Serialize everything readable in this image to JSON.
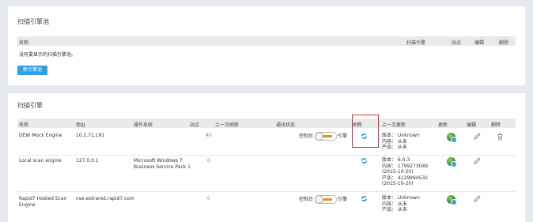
{
  "pool_panel": {
    "title": "扫描引擎池",
    "headers": {
      "name": "名称",
      "engines": "扫描引擎",
      "sites": "站点",
      "edit": "编辑",
      "delete": "删除"
    },
    "empty_text": "没有要显示的扫描引擎池。",
    "create_button": "新引擎池"
  },
  "engine_panel": {
    "title": "扫描引擎",
    "headers": {
      "name": "名称",
      "address": "地址",
      "os": "操作系统",
      "sites": "站点",
      "last_refresh": "上一次刷新",
      "comm_status": "通讯状态",
      "refresh": "刷新",
      "last_update": "上一次更新",
      "update": "更新",
      "edit": "编辑",
      "delete": "删除"
    },
    "toggle_left": "控制台",
    "toggle_right": "引擎",
    "rows": [
      {
        "name": "DEW Mock Engine",
        "address": "10.2.71.191",
        "os": "",
        "sites": "40",
        "update_lines": [
          "版本： Unknown",
          "内容： 从未",
          "产品： 从未"
        ],
        "has_delete": true
      },
      {
        "name": "Local scan engine",
        "address": "127.0.0.1",
        "os": "Microsoft Windows 7 Business Service Pack 1",
        "sites": "0",
        "update_lines": [
          "版本： 6.0.3",
          "内容： 1799273049",
          "(2015-10-20)",
          "产品： 4129994532",
          "(2015-10-20)"
        ],
        "has_delete": false
      },
      {
        "name": "Rapid7 Hosted Scan Engine",
        "address": "nse.extranet.rapid7.com",
        "os": "",
        "sites": "0",
        "update_lines": [
          "版本： Unknown",
          "内容： 从未",
          "产品： 从未"
        ],
        "has_delete": false
      }
    ]
  },
  "colors": {
    "accent": "#2aa3e6",
    "highlight": "#d9302f",
    "toggle_bar": "#f08a24"
  }
}
